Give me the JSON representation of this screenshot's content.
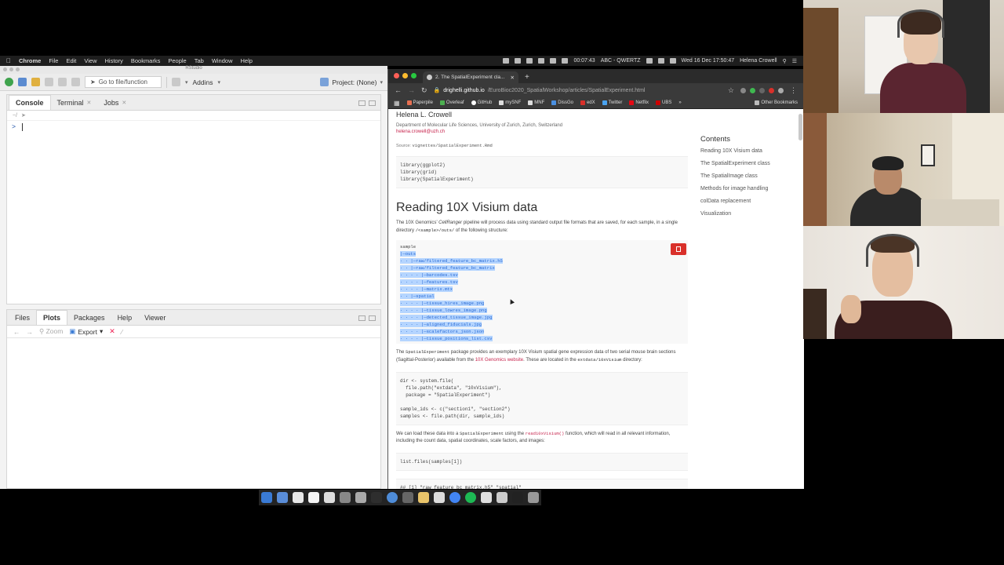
{
  "menubar": {
    "app": "Chrome",
    "items": [
      "File",
      "Edit",
      "View",
      "History",
      "Bookmarks",
      "People",
      "Tab",
      "Window",
      "Help"
    ],
    "time_elapsed": "00:07:43",
    "keyboard": "ABC - QWERTZ",
    "datetime": "Wed 16 Dec 17:50:47",
    "user": "Helena Crowell"
  },
  "rstudio": {
    "window_title": "RStudio",
    "goto_placeholder": "Go to file/function",
    "addins": "Addins",
    "project": "Project: (None)",
    "top_tabs": [
      "Console",
      "Terminal",
      "Jobs"
    ],
    "console_path": "~/",
    "prompt": ">",
    "bottom_tabs": [
      "Files",
      "Plots",
      "Packages",
      "Help",
      "Viewer"
    ],
    "zoom": "Zoom",
    "export": "Export"
  },
  "chrome": {
    "tab_title": "2. The SpatialExperiment cla...",
    "url_host": "drighelli.github.io",
    "url_path": "/EuroBioc2020_SpatialWorkshop/articles/SpatialExperiment.html",
    "bookmarks": [
      "Paperpile",
      "Overleaf",
      "GitHub",
      "mySNF",
      "MNF",
      "DissGo",
      "edX",
      "Twitter",
      "Netflix",
      "UBS"
    ],
    "other_bookmarks": "Other Bookmarks"
  },
  "article": {
    "author": "Helena L. Crowell",
    "affiliation": "Department of Molecular Life Sciences, University of Zurich, Zurich, Switzerland",
    "email": "helena.crowell@uzh.ch",
    "source_label": "Source:",
    "source_path": "vignettes/SpatialExperiment.Rmd",
    "library_code": "library(ggplot2)\nlibrary(grid)\nlibrary(SpatialExperiment)",
    "heading": "Reading 10X Visium data",
    "intro_1": "The 10X Genomics’",
    "intro_italic": "CellRanger",
    "intro_2": "pipeline will process data using standard output file formats that are saved, for each sample, in a single directory",
    "intro_code": "/<sample>/outs/",
    "intro_3": "of the following structure:",
    "tree": [
      "sample",
      "|—outs",
      "· · |—raw/filtered_feature_bc_matrix.h5",
      "· · |—raw/filtered_feature_bc_matrix",
      "· · · · |—barcodes.tsv",
      "· · · · |—features.tsv",
      "· · · · |—matrix.mtx",
      "· · |—spatial",
      "· · · · |—tissue_hires_image.png",
      "· · · · |—tissue_lowres_image.png",
      "· · · · |—detected_tissue_image.jpg",
      "· · · · |—aligned_fiducials.jpg",
      "· · · · |—scalefactors_json.json",
      "· · · · |—tissue_positions_list.csv"
    ],
    "para2_1": "The",
    "para2_code1": "SpatialExperiment",
    "para2_2": "package provides an exemplary 10X Visium spatial gene expression data of two serial mouse brain sections (Sagittal-Posterior) available from the",
    "para2_link": "10X Genomics website",
    "para2_3": ". These are located in the",
    "para2_code2": "extdata/10xVisium",
    "para2_4": "directory:",
    "dir_code": "dir <- system.file(\n  file.path(\"extdata\", \"10xVisium\"),\n  package = \"SpatialExperiment\")\n\nsample_ids <- c(\"section1\", \"section2\")\nsamples <- file.path(dir, sample_ids)",
    "para3_1": "We can load these data into a",
    "para3_code1": "SpatialExperiment",
    "para3_2": "using the",
    "para3_code2": "read10xVisium()",
    "para3_3": "function, which will read in all relevant information, including the count data, spatial coordinates, scale factors, and images:",
    "list_code": "list.files(samples[1])",
    "output_code": "## [1] \"raw_feature_bc_matrix.h5\" \"spatial\""
  },
  "toc": {
    "heading": "Contents",
    "items": [
      "Reading 10X Visium data",
      "The SpatialExperiment class",
      "The SpatialImage class",
      "Methods for image handling",
      "colData replacement",
      "Visualization"
    ]
  },
  "colors": {
    "selection": "#b5d5ff",
    "link": "#c7254e",
    "copy_button": "#d9302a"
  }
}
